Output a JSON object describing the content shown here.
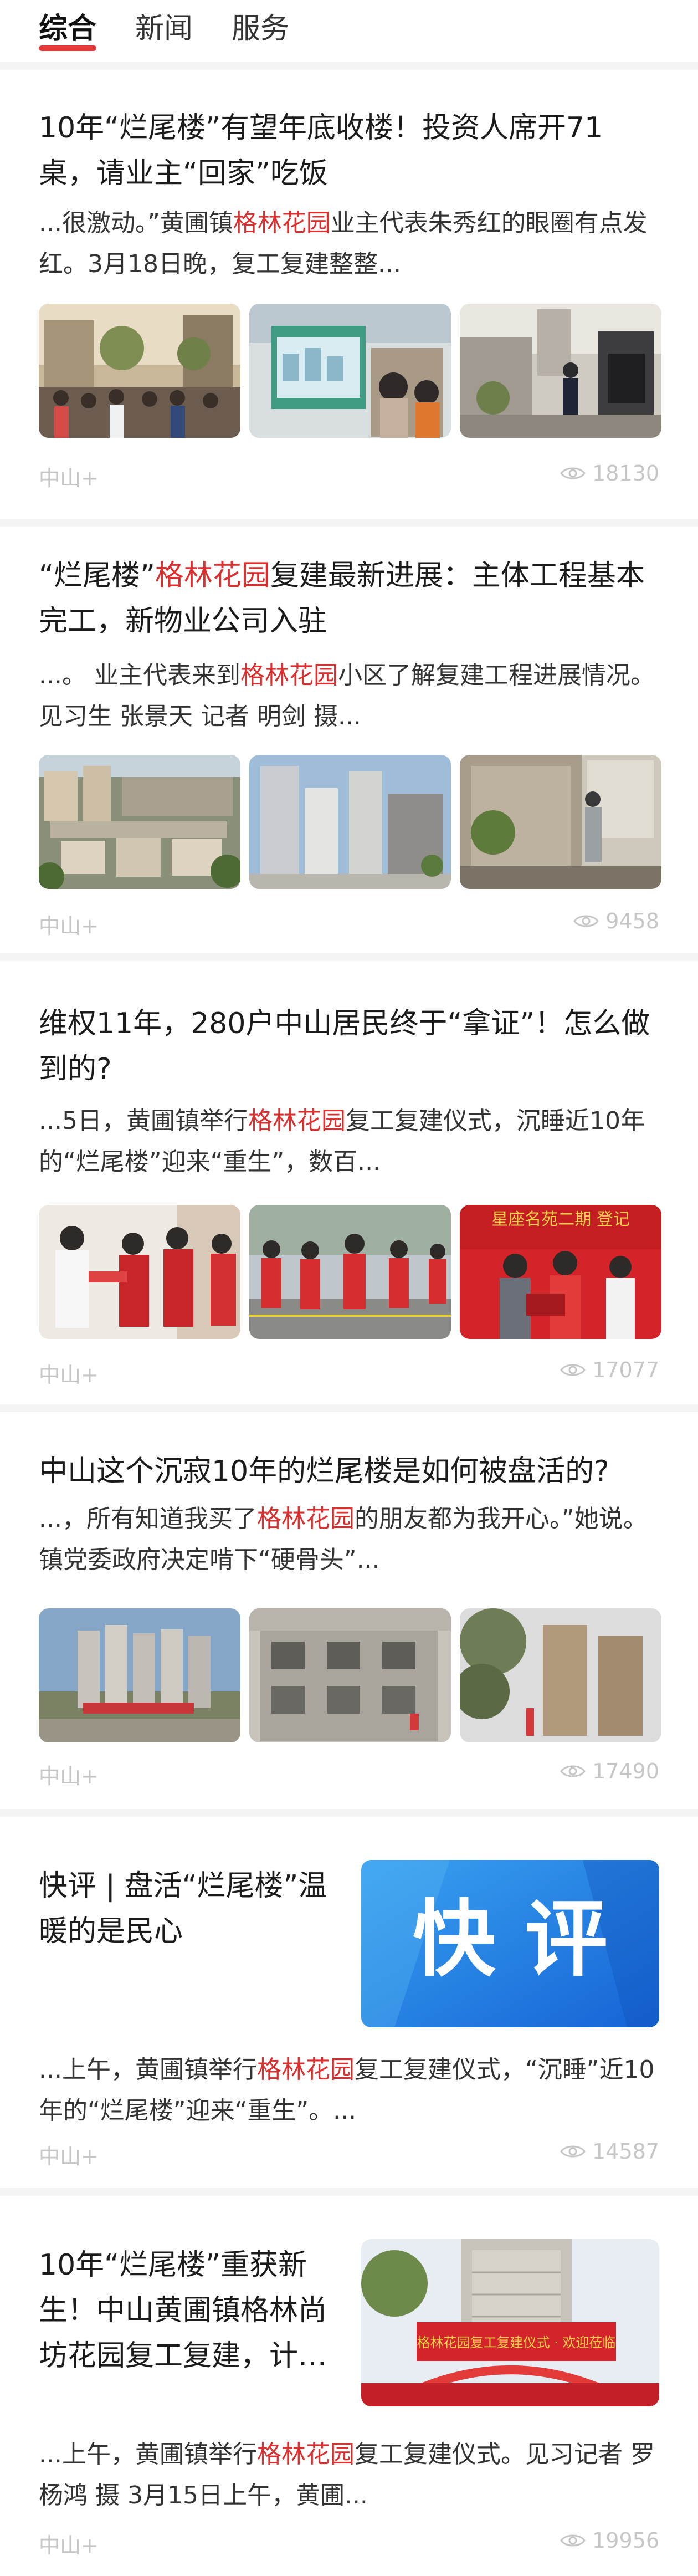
{
  "tabs": [
    {
      "label": "综合",
      "active": true
    },
    {
      "label": "新闻",
      "active": false
    },
    {
      "label": "服务",
      "active": false
    }
  ],
  "articles": [
    {
      "title": "10年“烂尾楼”有望年底收楼！投资人席开71桌，请业主“回家”吃饭",
      "snippet_pre": "...很激动。”黄圃镇",
      "snippet_hl": "格林花园",
      "snippet_post": "业主代表朱秀红的眼圈有点发红。3月18日晚，复工复建整整...",
      "source": "中山+",
      "views": "18130",
      "images": [
        "crowd-at-estate-photo",
        "development-billboard-photo",
        "security-guard-at-gate-photo"
      ]
    },
    {
      "title_pre": "“烂尾楼”",
      "title_hl": "格林花园",
      "title_post": "复建最新进展：主体工程基本完工，新物业公司入驻",
      "snippet_pre": "...。 业主代表来到",
      "snippet_hl": "格林花园",
      "snippet_post": "小区了解复建工程进展情况。见习生 张景天 记者 明剑 摄...",
      "source": "中山+",
      "views": "9458",
      "images": [
        "aerial-estate-photo",
        "residential-towers-photo",
        "construction-worker-photo"
      ]
    },
    {
      "title": "维权11年，280户中山居民终于“拿证”！怎么做到的?",
      "snippet_pre": "...5日，黄圃镇举行",
      "snippet_hl": "格林花园",
      "snippet_post": "复工复建仪式，沉睡近10年的“烂尾楼”迎来“重生”，数百...",
      "banner_text": "星座名苑二期 登记",
      "source": "中山+",
      "views": "17077",
      "images": [
        "volunteers-handover-photo",
        "volunteers-on-street-photo",
        "certificate-ceremony-photo"
      ]
    },
    {
      "title": "中山这个沉寂10年的烂尾楼是如何被盘活的?",
      "snippet_pre": "...，所有知道我买了",
      "snippet_hl": "格林花园",
      "snippet_post": "的朋友都为我开心。”她说。 镇党委政府决定啃下“硬骨头”...",
      "source": "中山+",
      "views": "17490",
      "images": [
        "aerial-towers-photo",
        "unfinished-building-photo",
        "tower-blocks-trees-photo"
      ]
    },
    {
      "title": "快评 | 盘活“烂尾楼”温暖的是民心",
      "thumb_text": "快 评",
      "snippet_pre": "...上午，黄圃镇举行",
      "snippet_hl": "格林花园",
      "snippet_post": "复工复建仪式，“沉睡”近10年的“烂尾楼”迎来“重生”。...",
      "source": "中山+",
      "views": "14587"
    },
    {
      "title": "10年“烂尾楼”重获新生！中山黄圃镇格林尚坊花园复工复建，计…",
      "thumb_text": "格林花园复工复建仪式 · 欢迎莅临",
      "snippet_pre": "...上午，黄圃镇举行",
      "snippet_hl": "格林花园",
      "snippet_post": "复工复建仪式。见习记者 罗杨鸿 摄 3月15日上午，黄圃...",
      "source": "中山+",
      "views": "19956"
    }
  ],
  "colors": {
    "accent": "#e33a3a",
    "highlight": "#d9302f",
    "meta": "#c6c6c6"
  }
}
